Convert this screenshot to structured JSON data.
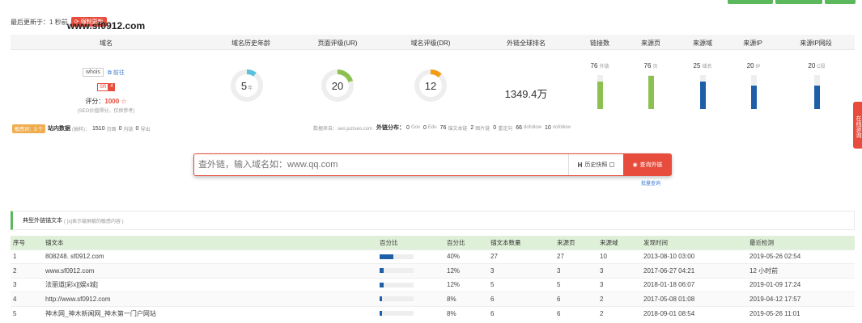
{
  "top": {
    "fragment": "···"
  },
  "updated": {
    "text": "最后更新于：1 秒前",
    "force_label": "强制更新"
  },
  "overview": {
    "columns": [
      "域名",
      "域名历史年龄",
      "页面评级(UR)",
      "域名评级(DR)",
      "外链全球排名",
      "链接数",
      "来源页",
      "来源域",
      "来源IP",
      "来源IP网段"
    ],
    "domain": "www.sf0912.com",
    "whois_label": "whois",
    "goto_label": "前往",
    "sr_label": "SR",
    "sr_value": "4",
    "score_label": "评分：",
    "score_value": "1000",
    "score_note": "(SEO价值得分，仅供参考)",
    "age": {
      "value": "5",
      "unit": "年",
      "fraction": 0.1
    },
    "ur": {
      "value": "20",
      "fraction": 0.2
    },
    "dr": {
      "value": "12",
      "fraction": 0.12
    },
    "rank": "1349.4万",
    "bars": [
      {
        "value": "76",
        "unit": "外链",
        "fraction": 0.82,
        "color": "#8cc152"
      },
      {
        "value": "76",
        "unit": "页",
        "fraction": 0.98,
        "color": "#8cc152"
      },
      {
        "value": "25",
        "unit": "域名",
        "fraction": 0.82,
        "color": "#1f5fa8"
      },
      {
        "value": "20",
        "unit": "IP",
        "fraction": 0.68,
        "color": "#1f5fa8"
      },
      {
        "value": "20",
        "unit": "C段",
        "fraction": 0.68,
        "color": "#1f5fa8"
      }
    ],
    "colors": {
      "age": "#5bc0de",
      "ur": "#8cc152",
      "dr": "#f39c12"
    }
  },
  "stats": {
    "sensitive": "敏感词：3 个",
    "site_label": "站内数据",
    "site_sub": "(抽样)：",
    "pages": "1510",
    "pages_unit": "页面",
    "internal": "0",
    "internal_unit": "内链",
    "export": "0",
    "export_unit": "导出",
    "source": "数据来自：seo.juziseo.com",
    "dist_label": "外链分布：",
    "gov": "0",
    "gov_unit": "Gov",
    "edu": "0",
    "edu_unit": "Edu",
    "anchor": "76",
    "anchor_unit": "锚文本链",
    "image": "2",
    "image_unit": "图片链",
    "redirect": "0",
    "redirect_unit": "重定向",
    "dofollow": "66",
    "dofollow_unit": "dofollow",
    "nofollow": "10",
    "nofollow_unit": "nofollow"
  },
  "search": {
    "placeholder": "查外链，输入域名如：www.qq.com",
    "hist_h": "H",
    "hist_label": "历史快照",
    "button_label": "查询外链",
    "batch_label": "批量查询"
  },
  "section": {
    "title": "典型外链锚文本",
    "note": "( [x]表示被屏蔽的敏感内容 )"
  },
  "table": {
    "headers": [
      "序号",
      "锚文本",
      "百分比",
      "百分比",
      "锚文本数量",
      "来源页",
      "来源域",
      "发现时间",
      "最近检测"
    ],
    "rows": [
      {
        "no": "1",
        "anchor": "808248. sf0912.com",
        "pct": "40%",
        "pct_frac": 0.4,
        "count": "27",
        "pages": "27",
        "domains": "10",
        "found": "2013-08-10 03:00",
        "checked": "2019-05-26 02:54"
      },
      {
        "no": "2",
        "anchor": "www.sf0912.com",
        "pct": "12%",
        "pct_frac": 0.12,
        "count": "3",
        "pages": "3",
        "domains": "3",
        "found": "2017-06-27 04:21",
        "checked": "12 小时前"
      },
      {
        "no": "3",
        "anchor": "法丽道[彩x][娱x城]",
        "pct": "12%",
        "pct_frac": 0.12,
        "count": "5",
        "pages": "5",
        "domains": "3",
        "found": "2018-01-18 06:07",
        "checked": "2019-01-09 17:24"
      },
      {
        "no": "4",
        "anchor": "http://www.sf0912.com",
        "pct": "8%",
        "pct_frac": 0.08,
        "count": "6",
        "pages": "6",
        "domains": "2",
        "found": "2017-05-08 01:08",
        "checked": "2019-04-12 17:57"
      },
      {
        "no": "5",
        "anchor": "神木网_神木新闻网_神木第一门户网站",
        "pct": "8%",
        "pct_frac": 0.08,
        "count": "6",
        "pages": "6",
        "domains": "2",
        "found": "2018-09-01 08:54",
        "checked": "2019-05-26 11:01"
      }
    ]
  },
  "sidetab": {
    "label": "在线咨询"
  }
}
